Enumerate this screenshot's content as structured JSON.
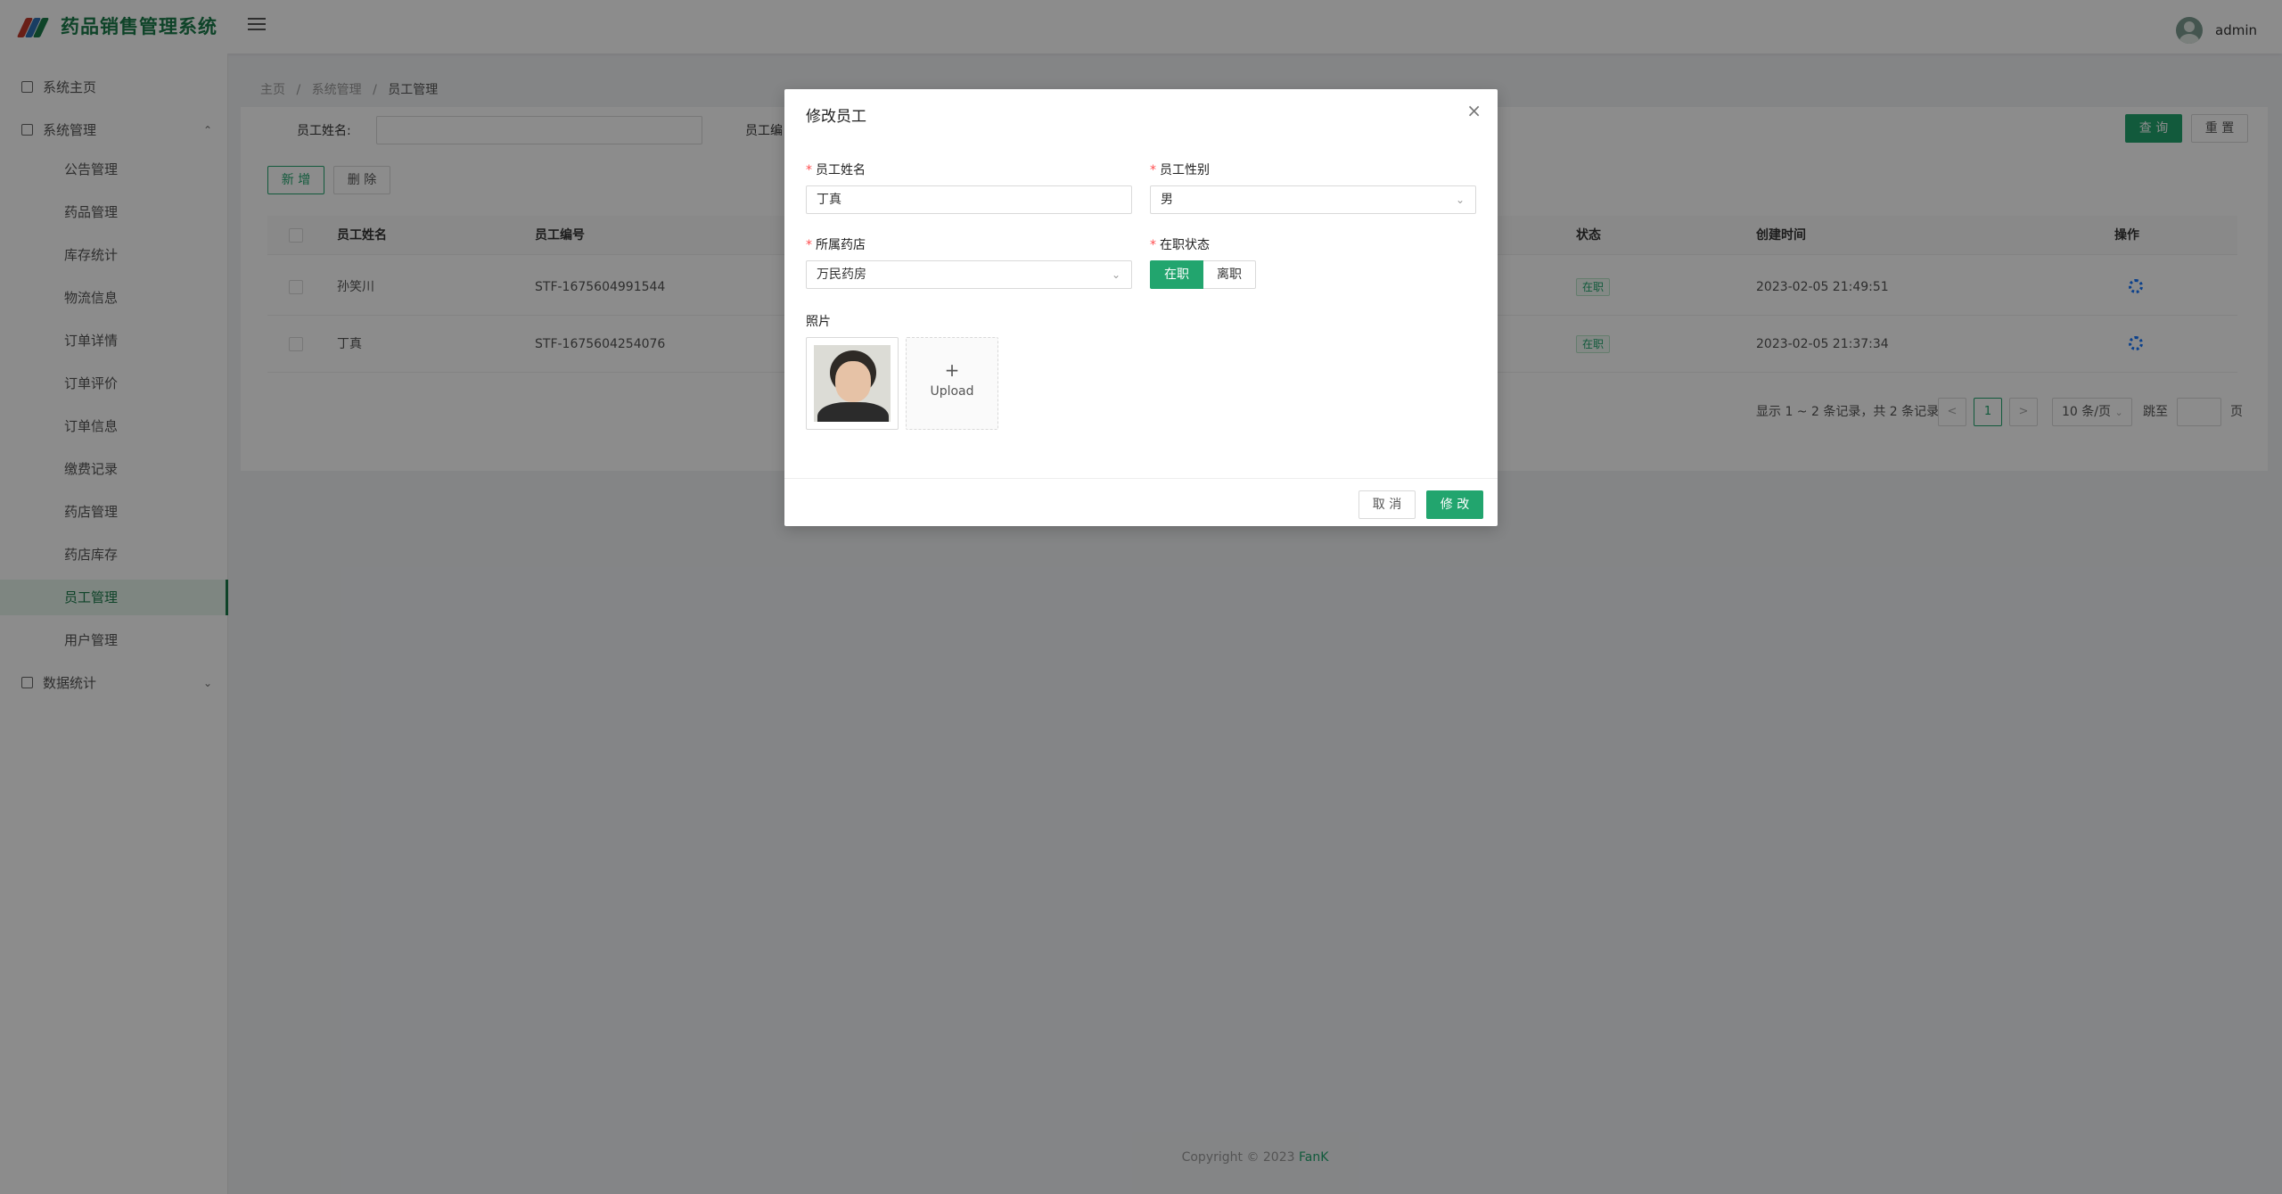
{
  "app": {
    "title": "药品销售管理系统",
    "username": "admin",
    "brand_color": "#1a7a4a",
    "accent_color": "#22a56e"
  },
  "sidebar": {
    "items": [
      {
        "label": "系统主页",
        "icon": "home-icon"
      },
      {
        "label": "系统管理",
        "icon": "appstore-icon",
        "expanded": true
      },
      {
        "label": "数据统计",
        "icon": "table-icon",
        "expanded": false
      }
    ],
    "submenu": [
      {
        "label": "公告管理"
      },
      {
        "label": "药品管理"
      },
      {
        "label": "库存统计"
      },
      {
        "label": "物流信息"
      },
      {
        "label": "订单详情"
      },
      {
        "label": "订单评价"
      },
      {
        "label": "订单信息"
      },
      {
        "label": "缴费记录"
      },
      {
        "label": "药店管理"
      },
      {
        "label": "药店库存"
      },
      {
        "label": "员工管理",
        "active": true
      },
      {
        "label": "用户管理"
      }
    ]
  },
  "breadcrumb": {
    "items": [
      "主页",
      "/",
      "系统管理",
      "/",
      "员工管理"
    ]
  },
  "search": {
    "name_label": "员工姓名:",
    "code_label": "员工编",
    "query_button": "查 询",
    "reset_button": "重 置"
  },
  "toolbar": {
    "add_button": "新 增",
    "delete_button": "删 除"
  },
  "table": {
    "columns": [
      "员工姓名",
      "员工编号",
      "状态",
      "创建时间",
      "操作"
    ],
    "rows": [
      {
        "name": "孙笑川",
        "code": "STF-1675604991544",
        "status": "在职",
        "created": "2023-02-05 21:49:51"
      },
      {
        "name": "丁真",
        "code": "STF-1675604254076",
        "status": "在职",
        "created": "2023-02-05 21:37:34"
      }
    ]
  },
  "pagination": {
    "summary": "显示 1 ~ 2 条记录，共 2 条记录",
    "prev": "<",
    "current_page": "1",
    "next": ">",
    "page_size": "10 条/页",
    "jump_label": "跳至",
    "page_suffix": "页"
  },
  "footer": {
    "copyright": "Copyright © 2023 ",
    "author": "FanK"
  },
  "modal": {
    "title": "修改员工",
    "close_icon": "×",
    "name_label": "员工姓名",
    "name_value": "丁真",
    "gender_label": "员工性别",
    "gender_value": "男",
    "store_label": "所属药店",
    "store_value": "万民药房",
    "status_label": "在职状态",
    "status_options": [
      "在职",
      "离职"
    ],
    "status_selected": "在职",
    "photo_label": "照片",
    "upload_plus": "+",
    "upload_text": "Upload",
    "cancel_button": "取 消",
    "submit_button": "修 改"
  }
}
